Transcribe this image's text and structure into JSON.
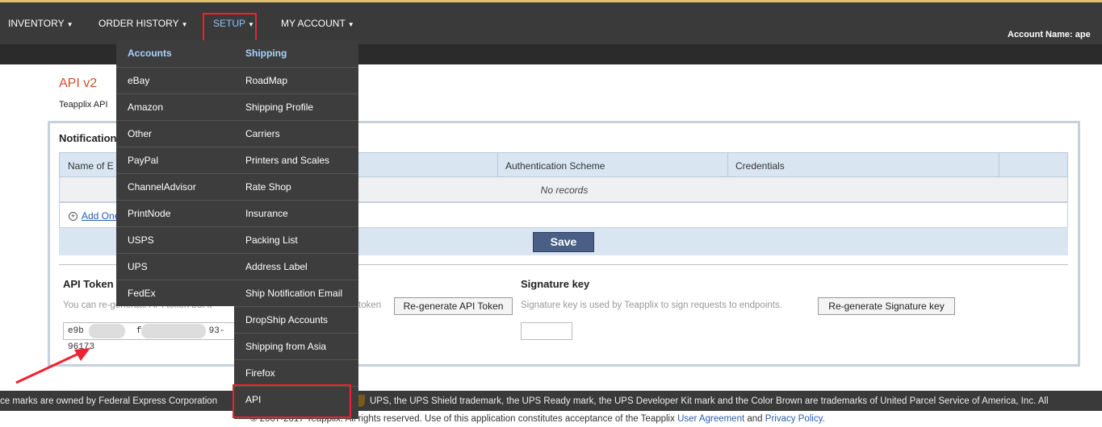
{
  "nav": {
    "items": [
      {
        "label": "INVENTORY"
      },
      {
        "label": "ORDER HISTORY"
      },
      {
        "label": "SETUP"
      },
      {
        "label": "MY ACCOUNT"
      }
    ],
    "account_label": "Account Name:",
    "account_value": "ape"
  },
  "page": {
    "title": "API v2",
    "subtitle": "Teapplix API"
  },
  "notifications": {
    "title": "Notification",
    "columns": [
      "Name of E",
      "Authentication Scheme",
      "Credentials"
    ],
    "empty_text": "No records",
    "add_link": "Add One",
    "save_label": "Save"
  },
  "api_token": {
    "title": "API Token",
    "help": "You can re-generate API token but it",
    "help_tail": "token",
    "button": "Re-generate API Token",
    "value_start": "e9b",
    "value_mid": "f3e",
    "value_end": "93-96173"
  },
  "signature": {
    "title": "Signature key",
    "help": "Signature key is used by Teapplix to sign requests to endpoints.",
    "button": "Re-generate Signature key"
  },
  "setup_menu": {
    "accounts_header": "Accounts",
    "accounts": [
      "eBay",
      "Amazon",
      "Other",
      "PayPal",
      "ChannelAdvisor",
      "PrintNode",
      "USPS",
      "UPS",
      "FedEx"
    ],
    "shipping_header": "Shipping",
    "shipping": [
      "RoadMap",
      "Shipping Profile",
      "Carriers",
      "Printers and Scales",
      "Rate Shop",
      "Insurance",
      "Packing List",
      "Address Label",
      "Ship Notification Email",
      "DropShip Accounts",
      "Shipping from Asia",
      "Firefox",
      "API"
    ]
  },
  "footer": {
    "left": "ce marks are owned by Federal Express Corporation",
    "right": "UPS, the UPS Shield trademark, the UPS Ready mark, the UPS Developer Kit mark and the Color Brown are trademarks of United Parcel Service of America, Inc. All",
    "copyright": "© 2007-2017 Teapplix. All rights reserved. Use of this application constitutes acceptance of the Teapplix",
    "user_agreement": "User Agreement",
    "and": "and",
    "privacy": "Privacy Policy",
    "period": "."
  },
  "colors": {
    "nav_bg": "#3a3a3a",
    "menu_bg": "#3d3d3d",
    "menu_header": "#a9d3ff",
    "title": "#d0502a",
    "save_button": "#4a5f86",
    "highlight": "#ee2233"
  }
}
